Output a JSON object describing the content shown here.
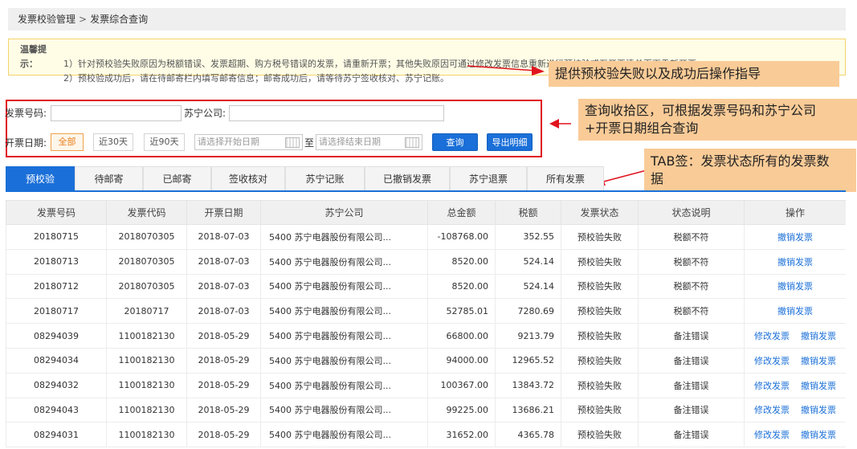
{
  "breadcrumb": {
    "level1": "发票校验管理",
    "sep": ">",
    "level2": "发票综合查询"
  },
  "tips": {
    "label": "温馨提示：",
    "line1": "1）针对预校验失败原因为税额错误、发票超期、购方税号错误的发票，请重新开票；其他失败原因可通过修改发票信息重新进行预校验或至开票清单页面重新开票。",
    "line2": "2）预校验成功后，请在待邮寄栏内填写邮寄信息；邮寄成功后，请等待苏宁签收核对、苏宁记账。"
  },
  "query": {
    "invoice_no_label": "发票号码:",
    "invoice_no_value": "",
    "company_label": "苏宁公司:",
    "company_value": "",
    "date_label": "开票日期:",
    "date_btns": [
      "全部",
      "近30天",
      "近90天"
    ],
    "start_placeholder": "请选择开始日期",
    "to_label": "至",
    "end_placeholder": "请选择结束日期",
    "search_label": "查询",
    "export_label": "导出明细"
  },
  "callouts": {
    "tips": "提供预校验失败以及成功后操作指导",
    "query_line1": "查询收拾区，可根据发票号码和苏宁公司",
    "query_line2": "+开票日期组合查询",
    "tabs_line1": "TAB签：发票状态所有的发票数",
    "tabs_line2": "据"
  },
  "tabs": [
    "预校验",
    "待邮寄",
    "已邮寄",
    "签收核对",
    "苏宁记账",
    "已撤销发票",
    "苏宁退票",
    "所有发票"
  ],
  "table": {
    "headers": [
      "发票号码",
      "发票代码",
      "开票日期",
      "苏宁公司",
      "总金额",
      "税额",
      "发票状态",
      "状态说明",
      "操作"
    ],
    "op_edit": "修改发票",
    "op_cancel": "撤销发票",
    "rows": [
      [
        "20180715",
        "2018070305",
        "2018-07-03",
        "5400 苏宁电器股份有限公司...",
        "-108768.00",
        "352.55",
        "预校验失败",
        "税额不符"
      ],
      [
        "20180713",
        "2018070305",
        "2018-07-03",
        "5400 苏宁电器股份有限公司...",
        "8520.00",
        "524.14",
        "预校验失败",
        "税额不符"
      ],
      [
        "20180712",
        "2018070305",
        "2018-07-03",
        "5400 苏宁电器股份有限公司...",
        "8520.00",
        "524.14",
        "预校验失败",
        "税额不符"
      ],
      [
        "20180717",
        "20180717",
        "2018-07-03",
        "5400 苏宁电器股份有限公司...",
        "52785.01",
        "7280.69",
        "预校验失败",
        "税额不符"
      ],
      [
        "08294039",
        "1100182130",
        "2018-05-29",
        "5400 苏宁电器股份有限公司...",
        "66800.00",
        "9213.79",
        "预校验失败",
        "备注错误"
      ],
      [
        "08294034",
        "1100182130",
        "2018-05-29",
        "5400 苏宁电器股份有限公司...",
        "94000.00",
        "12965.52",
        "预校验失败",
        "备注错误"
      ],
      [
        "08294032",
        "1100182130",
        "2018-05-29",
        "5400 苏宁电器股份有限公司...",
        "100367.00",
        "13843.72",
        "预校验失败",
        "备注错误"
      ],
      [
        "08294043",
        "1100182130",
        "2018-05-29",
        "5400 苏宁电器股份有限公司...",
        "99225.00",
        "13686.21",
        "预校验失败",
        "备注错误"
      ],
      [
        "08294031",
        "1100182130",
        "2018-05-29",
        "5400 苏宁电器股份有限公司...",
        "31652.00",
        "4365.78",
        "预校验失败",
        "备注错误"
      ]
    ],
    "ops_per_row": [
      [
        "cancel"
      ],
      [
        "cancel"
      ],
      [
        "cancel"
      ],
      [
        "cancel"
      ],
      [
        "edit",
        "cancel"
      ],
      [
        "edit",
        "cancel"
      ],
      [
        "edit",
        "cancel"
      ],
      [
        "edit",
        "cancel"
      ],
      [
        "edit",
        "cancel"
      ]
    ]
  }
}
